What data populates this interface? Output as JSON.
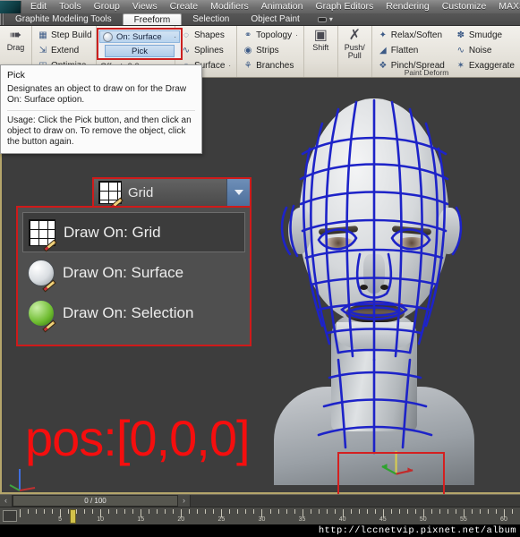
{
  "menubar": {
    "logo": "max-logo-icon",
    "items": [
      "Edit",
      "Tools",
      "Group",
      "Views",
      "Create",
      "Modifiers",
      "Animation",
      "Graph Editors",
      "Rendering",
      "Customize",
      "MAXS"
    ]
  },
  "ribbon_tabs": {
    "items": [
      {
        "label": "Graphite Modeling Tools",
        "active": false
      },
      {
        "label": "Freeform",
        "active": true
      },
      {
        "label": "Selection",
        "active": false
      },
      {
        "label": "Object Paint",
        "active": false
      }
    ],
    "minimize_icon": "minimize-ribbon-icon",
    "minimize_caret": "▾"
  },
  "ribbon": {
    "drag": {
      "label": "Drag",
      "icon": "drag-cursor-icon"
    },
    "polydraw": {
      "items": [
        {
          "label": "Step Build",
          "icon": "step-build-icon"
        },
        {
          "label": "Extend",
          "icon": "extend-icon"
        },
        {
          "label": "Optimize",
          "icon": "optimize-icon"
        }
      ]
    },
    "draw_on": {
      "surface_button": "On: Surface",
      "surface_caret": "·",
      "pick_button": "Pick",
      "offset_label": "Offset: 0.0",
      "offset_caret": "▴"
    },
    "topology": {
      "items": [
        {
          "label": "Shapes",
          "icon": "shapes-icon",
          "caret": ""
        },
        {
          "label": "Splines",
          "icon": "splines-icon",
          "caret": ""
        },
        {
          "label": "Surface",
          "icon": "surface-icon",
          "caret": "·"
        }
      ]
    },
    "topology2": {
      "items": [
        {
          "label": "Topology",
          "icon": "topology-icon",
          "caret": "·"
        },
        {
          "label": "Strips",
          "icon": "strips-icon",
          "caret": ""
        },
        {
          "label": "Branches",
          "icon": "branches-icon",
          "caret": ""
        }
      ]
    },
    "shift": {
      "label": "Shift",
      "icon": "shift-brush-icon"
    },
    "pushpull": {
      "label": "Push/ Pull",
      "icon": "push-pull-icon"
    },
    "deform": {
      "items": [
        {
          "label": "Relax/Soften",
          "icon": "relax-soften-icon"
        },
        {
          "label": "Flatten",
          "icon": "flatten-icon"
        },
        {
          "label": "Pinch/Spread",
          "icon": "pinch-spread-icon"
        },
        {
          "label": "Smudge",
          "icon": "smudge-icon"
        },
        {
          "label": "Noise",
          "icon": "noise-icon"
        },
        {
          "label": "Exaggerate",
          "icon": "exaggerate-icon"
        }
      ],
      "panel_label": "Paint Deform"
    }
  },
  "tooltip": {
    "title": "Pick",
    "description": "Designates an object to draw on for the Draw On: Surface option.",
    "usage": "Usage: Click the Pick button, and then click an object to draw on. To remove the object, click the button again."
  },
  "dropdown": {
    "selected_label": "Grid",
    "selected_icon": "draw-on-grid-icon",
    "caret_icon": "chevron-down-icon",
    "options": [
      {
        "label": "Draw On: Grid",
        "icon": "draw-on-grid-icon",
        "selected": true
      },
      {
        "label": "Draw On: Surface",
        "icon": "draw-on-surface-icon",
        "selected": false
      },
      {
        "label": "Draw On: Selection",
        "icon": "draw-on-selection-icon",
        "selected": false
      }
    ]
  },
  "viewport": {
    "annotation_text": "pos:[0,0,0]",
    "annotation_color": "#f50e0e",
    "highlight_box_color": "#d42020",
    "model_name": "head-mesh",
    "axis_tripod": "world-axis-tripod-icon",
    "background_color": "#3d3d3d"
  },
  "timeslider": {
    "prev_icon": "‹",
    "next_icon": "›",
    "frame_readout": "0 / 100"
  },
  "trackbar": {
    "key_filter_icon": "key-filter-icon",
    "tick_labels": [
      "5",
      "10",
      "15",
      "20",
      "25",
      "30",
      "35",
      "40",
      "45",
      "50",
      "55",
      "60"
    ]
  },
  "watermark": {
    "url": "http://lccnetvip.pixnet.net/album"
  }
}
